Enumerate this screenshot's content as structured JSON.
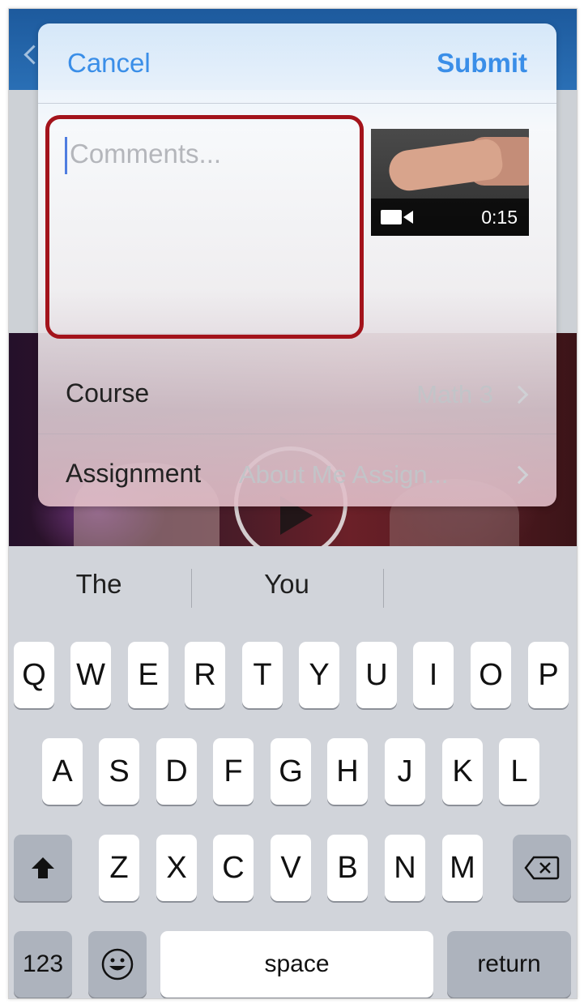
{
  "sheet": {
    "cancel_label": "Cancel",
    "submit_label": "Submit",
    "comments_placeholder": "Comments...",
    "attachment": {
      "duration": "0:15",
      "icon": "video-camera-icon"
    },
    "course_label": "Course",
    "course_value": "Math 3",
    "assignment_label": "Assignment",
    "assignment_value": "About Me Assign..."
  },
  "highlight_color": "#a3131b",
  "accent_color": "#3a8ee8",
  "keyboard": {
    "suggestions": [
      "The",
      "You",
      ""
    ],
    "row1": [
      "Q",
      "W",
      "E",
      "R",
      "T",
      "Y",
      "U",
      "I",
      "O",
      "P"
    ],
    "row2": [
      "A",
      "S",
      "D",
      "F",
      "G",
      "H",
      "J",
      "K",
      "L"
    ],
    "row3": [
      "Z",
      "X",
      "C",
      "V",
      "B",
      "N",
      "M"
    ],
    "numbers_label": "123",
    "space_label": "space",
    "return_label": "return",
    "shift_icon": "shift-arrow-icon",
    "delete_icon": "backspace-icon",
    "emoji_icon": "emoji-icon"
  }
}
